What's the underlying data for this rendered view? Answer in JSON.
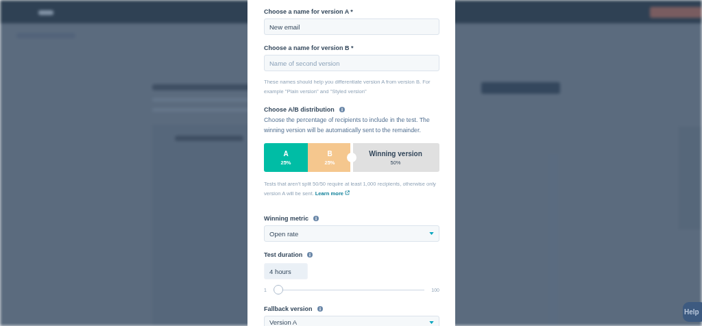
{
  "modal": {
    "name_a": {
      "label": "Choose a name for version A *",
      "value": "New email"
    },
    "name_b": {
      "label": "Choose a name for version B *",
      "placeholder": "Name of second version"
    },
    "names_help": "These names should help you differentiate version A from version B. For example \"Plain version\" and \"Styled version\"",
    "distribution": {
      "label": "Choose A/B distribution",
      "description": "Choose the percentage of recipients to include in the test. The winning version will be automatically sent to the remainder.",
      "segments": [
        {
          "name": "A",
          "percent": "25%",
          "color": "#00bda5"
        },
        {
          "name": "B",
          "percent": "25%",
          "color": "#f5c78e"
        }
      ],
      "winning": {
        "name": "Winning version",
        "percent": "50%"
      },
      "note": "Tests that aren't split 50/50 require at least 1,000 recipients, otherwise only version A will be sent.",
      "link": "Learn more"
    },
    "winning_metric": {
      "label": "Winning metric",
      "value": "Open rate"
    },
    "test_duration": {
      "label": "Test duration",
      "value": "4 hours",
      "min": "1",
      "max": "100",
      "level": 0.03
    },
    "fallback_version": {
      "label": "Fallback version",
      "value": "Version A"
    }
  },
  "help_button": "Help"
}
